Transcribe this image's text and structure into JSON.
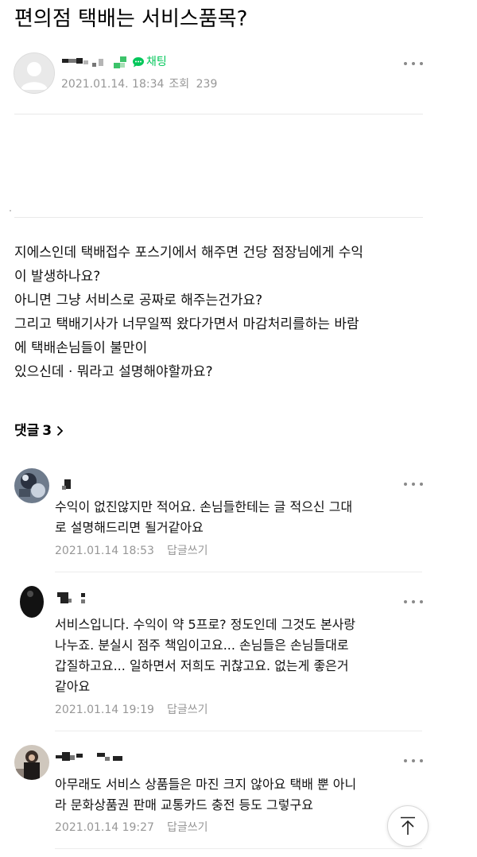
{
  "post": {
    "title": "편의점 택배는 서비스품목?",
    "chat_label": "채팅",
    "date": "2021.01.14. 18:34",
    "views_label": "조회",
    "views_count": "239",
    "body_lines": [
      "지에스인데 택배접수  포스기에서  해주면 건당 점장님에게 수익",
      "이 발생하나요?",
      "아니면  그냥 서비스로 공짜로 해주는건가요?",
      "그리고  택배기사가  너무일찍 왔다가면서 마감처리를하는 바람",
      "에 택배손님들이 불만이",
      "있으신데  · 뭐라고 설명해야할까요?"
    ]
  },
  "comments_section": {
    "label": "댓글",
    "count": "3"
  },
  "comments": [
    {
      "lines": [
        "수익이 없진않지만 적어요. 손님들한테는 글 적으신 그대",
        "로 설명해드리면 될거같아요"
      ],
      "date": "2021.01.14 18:53",
      "reply_label": "답글쓰기"
    },
    {
      "lines": [
        "서비스입니다. 수익이 약 5프로? 정도인데 그것도 본사랑",
        "나누죠. 분실시 점주 책임이고요... 손님들은 손님들대로",
        "갑질하고요... 일하면서 저희도 귀찮고요. 없는게 좋은거",
        "같아요"
      ],
      "date": "2021.01.14 19:19",
      "reply_label": "답글쓰기"
    },
    {
      "lines": [
        "아무래도 서비스 상품들은 마진 크지 않아요 택배 뿐 아니",
        "라 문화상품권 판매 교통카드 충전 등도 그렇구요"
      ],
      "date": "2021.01.14 19:27",
      "reply_label": "답글쓰기"
    }
  ],
  "colors": {
    "chat_green": "#03c75a",
    "meta_gray": "#979797",
    "divider": "#e9e9e9"
  },
  "icons": {
    "author_avatar": "default-person-icon",
    "chat": "chat-bubble-icon",
    "more": "more-dots-icon",
    "comment_chevron": "chevron-right-icon",
    "top": "arrow-up-icon"
  }
}
